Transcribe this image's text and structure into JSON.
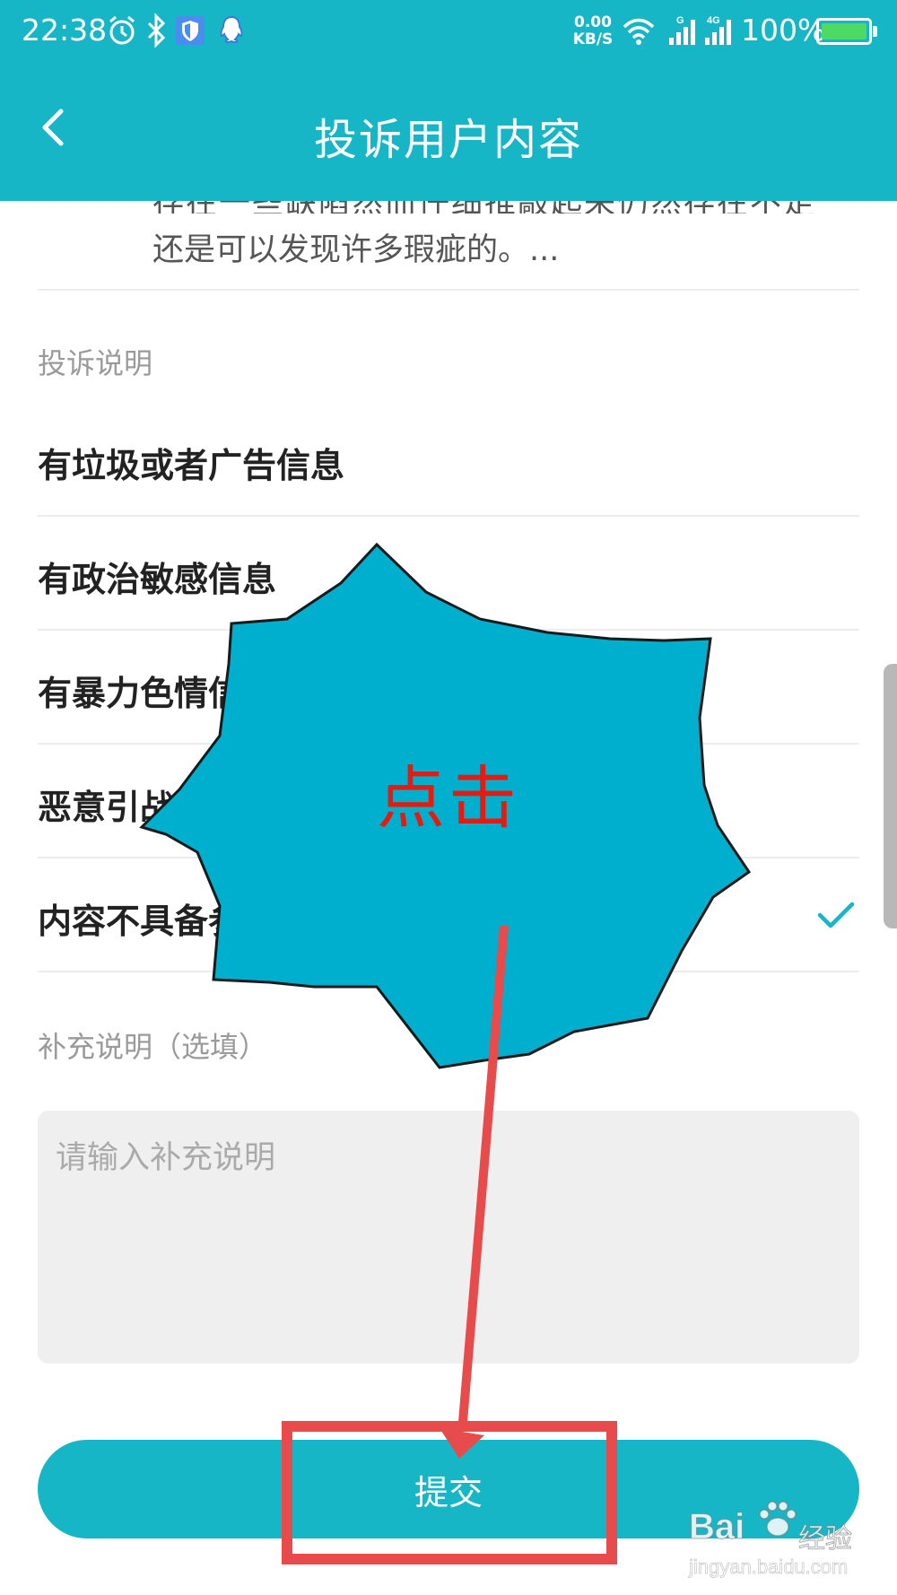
{
  "status_bar": {
    "time": "22:38",
    "net_speed_value": "0.00",
    "net_speed_unit": "KB/S",
    "battery_percent": "100%",
    "network_type": "4G",
    "signal_sub": "G"
  },
  "header": {
    "title": "投诉用户内容"
  },
  "previous_content": {
    "partial_line": "存在一些缺陷然而仔细推敲起来仍然存在不足",
    "last_line": "还是可以发现许多瑕疵的。..."
  },
  "complaint_section": {
    "label": "投诉说明",
    "options": [
      {
        "label": "有垃圾或者广告信息",
        "selected": false
      },
      {
        "label": "有政治敏感信息",
        "selected": false
      },
      {
        "label": "有暴力色情信息",
        "selected": false
      },
      {
        "label": "恶意引战",
        "selected": false
      },
      {
        "label": "内容不具备参考价值",
        "selected": true
      }
    ]
  },
  "supplement": {
    "label": "补充说明（选填）",
    "placeholder": "请输入补充说明",
    "value": ""
  },
  "submit": {
    "label": "提交"
  },
  "annotation": {
    "text": "点击",
    "callout_color": "#00afce",
    "arrow_color": "#e84b4b",
    "highlight_color": "#e84b4b"
  },
  "watermark": {
    "brand": "Bai",
    "brand_cn": "经验",
    "url": "jingyan.baidu.com"
  },
  "colors": {
    "accent": "#17b6c6",
    "check": "#17b6c6",
    "input_bg": "#efefef"
  }
}
